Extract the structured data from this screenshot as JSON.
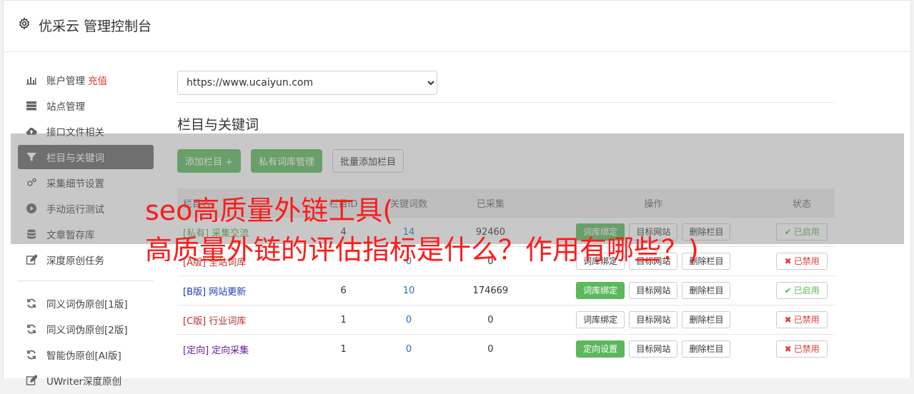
{
  "header": {
    "title": "优采云 管理控制台"
  },
  "sidebar": {
    "items": [
      {
        "label": "账户管理",
        "badge": "充值",
        "icon": "bar-chart-icon"
      },
      {
        "label": "站点管理",
        "icon": "server-icon"
      },
      {
        "label": "接口文件相关",
        "icon": "cloud-upload-icon"
      },
      {
        "label": "栏目与关键词",
        "icon": "filter-icon",
        "active": true
      },
      {
        "label": "采集细节设置",
        "icon": "cogs-icon"
      },
      {
        "label": "手动运行测试",
        "icon": "play-icon"
      },
      {
        "label": "文章暂存库",
        "icon": "database-icon"
      },
      {
        "label": "深度原创任务",
        "icon": "edit-icon"
      }
    ],
    "items2": [
      {
        "label": "同义词伪原创[1版]",
        "icon": "refresh-icon"
      },
      {
        "label": "同义词伪原创[2版]",
        "icon": "refresh-icon"
      },
      {
        "label": "智能伪原创[AI版]",
        "icon": "refresh-icon"
      },
      {
        "label": "UWriter深度原创",
        "icon": "edit-icon"
      }
    ]
  },
  "main": {
    "site_select": {
      "value": "https://www.ucaiyun.com",
      "options": [
        "https://www.ucaiyun.com"
      ]
    },
    "section_title": "栏目与关键词",
    "buttons": {
      "add_column": "添加栏目 +",
      "private_lib": "私有词库管理",
      "batch_add": "批量添加栏目"
    },
    "table": {
      "headers": [
        "栏目名",
        "栏目ID",
        "关键词数",
        "已采集",
        "操作",
        "状态"
      ],
      "rows": [
        {
          "tag": "[私有]",
          "name": "采集交流",
          "id": "4",
          "kw": "14",
          "collected": "92460",
          "bind": "词库绑定",
          "bind_green": true,
          "site": "目标网站",
          "del": "删除栏目",
          "status": "已启用",
          "on": true,
          "tag_class": "t-private"
        },
        {
          "tag": "[A版]",
          "name": "全站词库",
          "id": "",
          "kw": "0",
          "collected": "0",
          "bind": "词库绑定",
          "bind_green": false,
          "site": "目标网站",
          "del": "删除栏目",
          "status": "已禁用",
          "on": false,
          "tag_class": "t-a"
        },
        {
          "tag": "[B版]",
          "name": "网站更新",
          "id": "6",
          "kw": "10",
          "collected": "174669",
          "bind": "词库绑定",
          "bind_green": true,
          "site": "目标网站",
          "del": "删除栏目",
          "status": "已启用",
          "on": true,
          "tag_class": "t-b"
        },
        {
          "tag": "[C版]",
          "name": "行业词库",
          "id": "1",
          "kw": "0",
          "collected": "0",
          "bind": "词库绑定",
          "bind_green": false,
          "site": "目标网站",
          "del": "删除栏目",
          "status": "已禁用",
          "on": false,
          "tag_class": "t-c"
        },
        {
          "tag": "[定向]",
          "name": "定向采集",
          "id": "1",
          "kw": "0",
          "collected": "0",
          "bind": "定向设置",
          "bind_green": true,
          "site": "目标网站",
          "del": "删除栏目",
          "status": "已禁用",
          "on": false,
          "tag_class": "t-dir"
        }
      ]
    }
  },
  "overlay": {
    "line1": "seo高质量外链工具(",
    "line2": "高质量外链的评估指标是什么？作用有哪些？)"
  },
  "colors": {
    "accent_green": "#5cb85c",
    "danger_red": "#e53935",
    "active_nav": "#666666"
  }
}
